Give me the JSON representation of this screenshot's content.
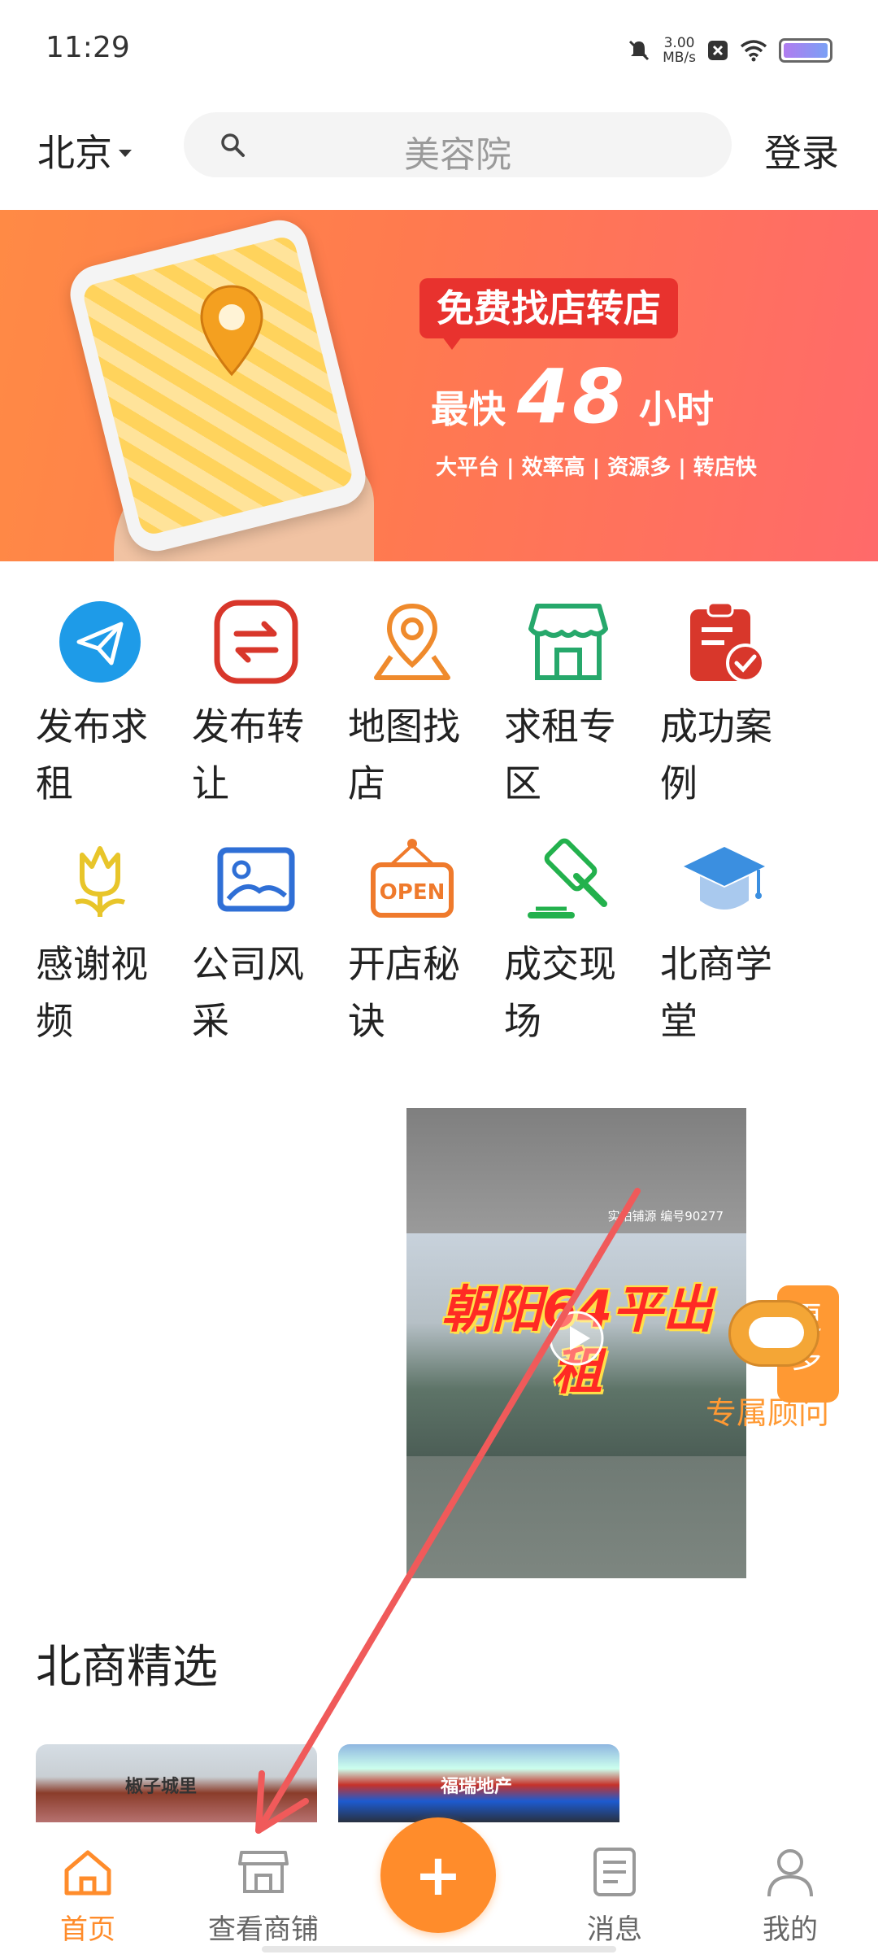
{
  "status_bar": {
    "time": "11:29",
    "net_speed_value": "3.00",
    "net_speed_unit": "MB/s"
  },
  "header": {
    "city": "北京",
    "search_placeholder": "美容院",
    "login": "登录"
  },
  "banner": {
    "badge": "免费找店转店",
    "headline_pre": "最快",
    "headline_num": "48",
    "headline_post": "小时",
    "subline": "大平台 | 效率高 | 资源多 | 转店快"
  },
  "grid": {
    "items": [
      {
        "label": "发布求租",
        "icon": "paper-plane-icon"
      },
      {
        "label": "发布转让",
        "icon": "transfer-arrows-icon"
      },
      {
        "label": "地图找店",
        "icon": "map-pin-icon"
      },
      {
        "label": "求租专区",
        "icon": "storefront-icon"
      },
      {
        "label": "成功案例",
        "icon": "clipboard-check-icon"
      },
      {
        "label": "感谢视频",
        "icon": "flower-icon"
      },
      {
        "label": "公司风采",
        "icon": "image-icon"
      },
      {
        "label": "开店秘诀",
        "icon": "open-sign-icon"
      },
      {
        "label": "成交现场",
        "icon": "gavel-icon"
      },
      {
        "label": "北商学堂",
        "icon": "graduation-cap-icon"
      }
    ]
  },
  "video": {
    "tag": "实拍铺源 编号90277",
    "title": "朝阳64平出租"
  },
  "consultant": {
    "box_text": "更多",
    "label": "专属顾问"
  },
  "section": {
    "title": "北商精选"
  },
  "thumbs": [
    {
      "text": "椒子城里"
    },
    {
      "text": "福瑞地产"
    }
  ],
  "bottom_nav": {
    "items": [
      {
        "label": "首页",
        "icon": "home-icon",
        "active": true
      },
      {
        "label": "查看商铺",
        "icon": "shop-icon",
        "active": false
      },
      {
        "label": "消息",
        "icon": "message-doc-icon",
        "active": false
      },
      {
        "label": "我的",
        "icon": "user-icon",
        "active": false
      }
    ],
    "fab_label": "+"
  },
  "colors": {
    "accent": "#ff8c2b",
    "banner_red": "#e8322e",
    "annotation_arrow": "#f05a5a"
  }
}
